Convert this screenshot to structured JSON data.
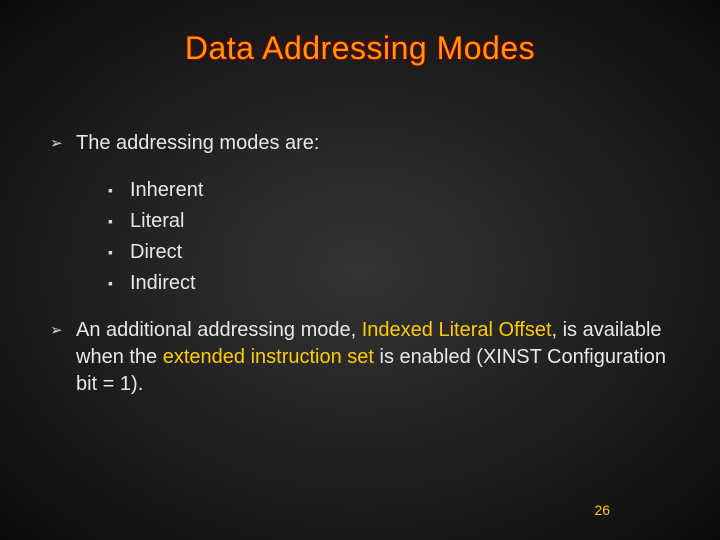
{
  "title": "Data Addressing Modes",
  "bullets": {
    "top1": "The addressing modes are:",
    "sub": {
      "a": "Inherent",
      "b": "Literal",
      "c": "Direct",
      "d": "Indirect"
    },
    "top2": {
      "pre": "An additional addressing mode, ",
      "hl1": "Indexed Literal Offset",
      "mid": ", is available when the ",
      "hl2": "extended instruction set",
      "post": " is enabled (XINST Configuration bit = 1)."
    }
  },
  "glyphs": {
    "top_bullet": "➢",
    "sub_bullet": "▪"
  },
  "page_number": "26"
}
